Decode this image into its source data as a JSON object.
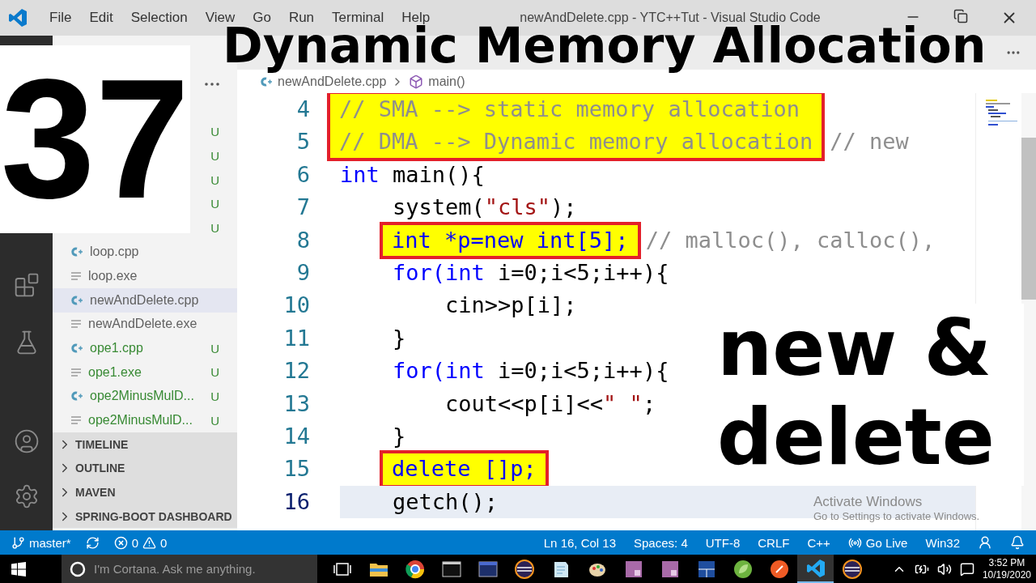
{
  "title_bar": {
    "menu": [
      "File",
      "Edit",
      "Selection",
      "View",
      "Go",
      "Run",
      "Terminal",
      "Help"
    ],
    "title": "newAndDelete.cpp - YTC++Tut - Visual Studio Code"
  },
  "overlay": {
    "heading": "Dynamic Memory Allocation",
    "episode": "37",
    "caption_lines": [
      "new &",
      "delete"
    ]
  },
  "sidebar": {
    "files": [
      {
        "status": "U"
      },
      {
        "status": "U"
      },
      {
        "status": "U"
      },
      {
        "status": "U"
      },
      {
        "status": "U"
      },
      {
        "name": "loop.cpp",
        "kind": "cpp",
        "selected": false
      },
      {
        "name": "loop.exe",
        "kind": "exe",
        "selected": false
      },
      {
        "name": "newAndDelete.cpp",
        "kind": "cpp",
        "selected": true
      },
      {
        "name": "newAndDelete.exe",
        "kind": "exe",
        "selected": false
      },
      {
        "name": "ope1.cpp",
        "kind": "cpp",
        "status": "U",
        "selected": false
      },
      {
        "name": "ope1.exe",
        "kind": "exe",
        "status": "U",
        "selected": false
      },
      {
        "name": "ope2MinusMulD...",
        "kind": "cpp",
        "status": "U",
        "selected": false
      },
      {
        "name": "ope2MinusMulD...",
        "kind": "exe",
        "status": "U",
        "selected": false
      }
    ],
    "sections": [
      "TIMELINE",
      "OUTLINE",
      "MAVEN",
      "SPRING-BOOT DASHBOARD"
    ]
  },
  "breadcrumb": {
    "file": "newAndDelete.cpp",
    "symbol": "main()"
  },
  "editor": {
    "blocks": [
      {
        "kind": "boxed",
        "lines": [
          {
            "number": "4",
            "current": false,
            "tokens": [
              {
                "text": "// SMA --> static memory allocation",
                "kind": "comment"
              }
            ]
          },
          {
            "number": "5",
            "current": false,
            "tokens": [
              {
                "text": "// DMA --> Dynamic memory allocation",
                "kind": "comment"
              }
            ],
            "tail": [
              {
                "text": "// new",
                "kind": "comment"
              }
            ]
          }
        ]
      },
      {
        "kind": "line",
        "number": "6",
        "current": false,
        "tokens": [
          {
            "text": "int",
            "kind": "keyword"
          },
          {
            "text": " main(){",
            "kind": "plain"
          }
        ],
        "children": [
          {
            "kind": "line",
            "number": "7",
            "current": false,
            "tokens": [
              {
                "text": "system(",
                "kind": "plain"
              },
              {
                "text": "\"cls\"",
                "kind": "string"
              },
              {
                "text": ");",
                "kind": "plain"
              }
            ]
          },
          {
            "kind": "boxed",
            "lines": [
              {
                "number": "8",
                "current": false,
                "tokens": [
                  {
                    "text": "int *p=new int[5];",
                    "kind": "keyword"
                  }
                ],
                "tail": [
                  {
                    "text": "// malloc(), calloc(),",
                    "kind": "comment"
                  }
                ]
              }
            ]
          },
          {
            "kind": "line",
            "number": "9",
            "current": false,
            "tokens": [
              {
                "text": "for(int",
                "kind": "keyword"
              },
              {
                "text": " i=0;i<5;i++){",
                "kind": "plain"
              }
            ],
            "children": [
              {
                "kind": "line",
                "number": "10",
                "current": false,
                "tokens": [
                  {
                    "text": "cin>>p[i];",
                    "kind": "plain"
                  }
                ]
              }
            ]
          },
          {
            "kind": "line",
            "number": "11",
            "current": false,
            "tokens": [
              {
                "text": "}",
                "kind": "plain"
              }
            ]
          },
          {
            "kind": "line",
            "number": "12",
            "current": false,
            "tokens": [
              {
                "text": "for(int",
                "kind": "keyword"
              },
              {
                "text": " i=0;i<5;i++){",
                "kind": "plain"
              }
            ],
            "children": [
              {
                "kind": "line",
                "number": "13",
                "current": false,
                "tokens": [
                  {
                    "text": "cout<<p[i]<<",
                    "kind": "plain"
                  },
                  {
                    "text": "\" \"",
                    "kind": "string"
                  },
                  {
                    "text": ";",
                    "kind": "plain"
                  }
                ]
              }
            ]
          },
          {
            "kind": "line",
            "number": "14",
            "current": false,
            "tokens": [
              {
                "text": "}",
                "kind": "plain"
              }
            ]
          },
          {
            "kind": "boxed",
            "lines": [
              {
                "number": "15",
                "current": false,
                "tokens": [
                  {
                    "text": "delete []p;",
                    "kind": "keyword"
                  }
                ]
              }
            ]
          },
          {
            "kind": "line",
            "number": "16",
            "current": true,
            "tokens": [
              {
                "text": "getch();",
                "kind": "plain"
              }
            ]
          }
        ]
      }
    ]
  },
  "activation": {
    "title": "Activate Windows",
    "hint": "Go to Settings to activate Windows."
  },
  "status_bar": {
    "branch": "master*",
    "errors": "0",
    "warnings": "0",
    "items": [
      "Ln 16, Col 13",
      "Spaces: 4",
      "UTF-8",
      "CRLF",
      "C++"
    ],
    "live": "Go Live",
    "platform": "Win32"
  },
  "taskbar": {
    "search_placeholder": "I'm Cortana. Ask me anything.",
    "apps": [
      {
        "kind": "folder",
        "active": false
      },
      {
        "kind": "browser",
        "active": false
      },
      {
        "kind": "terminal",
        "active": false
      },
      {
        "kind": "monitor",
        "active": false
      },
      {
        "kind": "ring",
        "active": false
      },
      {
        "kind": "notepad",
        "active": false
      },
      {
        "kind": "palette",
        "active": false
      },
      {
        "kind": "tile",
        "active": false
      },
      {
        "kind": "tile",
        "active": false
      },
      {
        "kind": "grid",
        "active": false
      },
      {
        "kind": "leaf",
        "active": false
      },
      {
        "kind": "orange",
        "active": false
      },
      {
        "kind": "vscode",
        "active": true
      },
      {
        "kind": "ring",
        "active": false
      }
    ],
    "time": "3:52 PM",
    "date": "10/19/2020"
  }
}
